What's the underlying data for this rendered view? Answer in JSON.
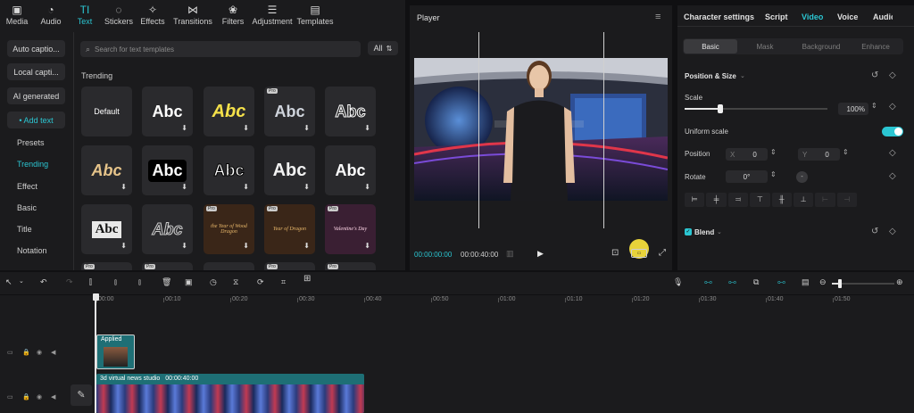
{
  "nav": {
    "tabs": [
      {
        "icon": "media-icon",
        "label": "Media",
        "glyph": "▣"
      },
      {
        "icon": "audio-icon",
        "label": "Audio",
        "glyph": "◔"
      },
      {
        "icon": "text-icon",
        "label": "Text",
        "glyph": "TI"
      },
      {
        "icon": "stickers-icon",
        "label": "Stickers",
        "glyph": "◌"
      },
      {
        "icon": "effects-icon",
        "label": "Effects",
        "glyph": "✧"
      },
      {
        "icon": "transitions-icon",
        "label": "Transitions",
        "glyph": "⋈"
      },
      {
        "icon": "filters-icon",
        "label": "Filters",
        "glyph": "❀"
      },
      {
        "icon": "adjustment-icon",
        "label": "Adjustment",
        "glyph": "☰"
      },
      {
        "icon": "templates-icon",
        "label": "Templates",
        "glyph": "▤"
      }
    ],
    "active_index": 2
  },
  "sidebar": {
    "buttons": [
      "Auto captio...",
      "Local capti...",
      "AI generated",
      "• Add text"
    ],
    "items": [
      "Presets",
      "Trending",
      "Effect",
      "Basic",
      "Title",
      "Notation"
    ],
    "active_item": "Trending"
  },
  "search": {
    "placeholder": "Search for text templates",
    "all_label": "All"
  },
  "trending_label": "Trending",
  "templates": [
    {
      "text": "Default",
      "style": "default",
      "pro": false,
      "dl": false
    },
    {
      "text": "Abc",
      "style": "plain",
      "pro": false,
      "dl": true
    },
    {
      "text": "Abc",
      "style": "yellow-italic",
      "pro": false,
      "dl": true
    },
    {
      "text": "Abc",
      "style": "silver",
      "pro": true,
      "dl": true
    },
    {
      "text": "Abc",
      "style": "outline",
      "pro": false,
      "dl": true
    },
    {
      "text": "Abc",
      "style": "gold",
      "pro": false,
      "dl": true
    },
    {
      "text": "Abc",
      "style": "black-box",
      "pro": false,
      "dl": true
    },
    {
      "text": "Abc",
      "style": "black-stroke",
      "pro": false,
      "dl": true
    },
    {
      "text": "Abc",
      "style": "bold-grey",
      "pro": false,
      "dl": true
    },
    {
      "text": "Abc",
      "style": "white-bold",
      "pro": false,
      "dl": true
    },
    {
      "text": "Abc",
      "style": "white-box",
      "pro": false,
      "dl": true
    },
    {
      "text": "Abc",
      "style": "hollow",
      "pro": false,
      "dl": true
    },
    {
      "text": "the Year of Wood Dragon",
      "style": "dragon",
      "pro": true,
      "dl": true
    },
    {
      "text": "Year of Dragon",
      "style": "dragon2",
      "pro": true,
      "dl": true
    },
    {
      "text": "Valentine's Day",
      "style": "valentine",
      "pro": true,
      "dl": true
    }
  ],
  "player": {
    "title": "Player",
    "current_time": "00:00:00:00",
    "total_time": "00:00:40:00"
  },
  "right": {
    "tabs": [
      "Character settings",
      "Script",
      "Video",
      "Voice",
      "Audio"
    ],
    "active_tab": "Video",
    "subtabs": [
      "Basic",
      "Mask",
      "Background",
      "Enhance"
    ],
    "active_subtab": "Basic",
    "position_size": "Position & Size",
    "scale_label": "Scale",
    "scale_value": "100%",
    "scale_fraction": 0.25,
    "uniform_scale": "Uniform scale",
    "position_label": "Position",
    "pos_x_label": "X",
    "pos_x": "0",
    "pos_y_label": "Y",
    "pos_y": "0",
    "rotate_label": "Rotate",
    "rotate_value": "0°",
    "blend_label": "Blend"
  },
  "timeline": {
    "ticks": [
      "00:00",
      "00:10",
      "00:20",
      "00:30",
      "00:40",
      "00:50",
      "01:00",
      "01:10",
      "01:20",
      "01:30",
      "01:40",
      "01:50"
    ],
    "overlay_clip_label": "Applied",
    "main_clip_label": "3d virtual news studio",
    "main_clip_duration": "00:00:40:00"
  },
  "colors": {
    "accent": "#2bc6d2",
    "clip": "#1e6f75"
  }
}
